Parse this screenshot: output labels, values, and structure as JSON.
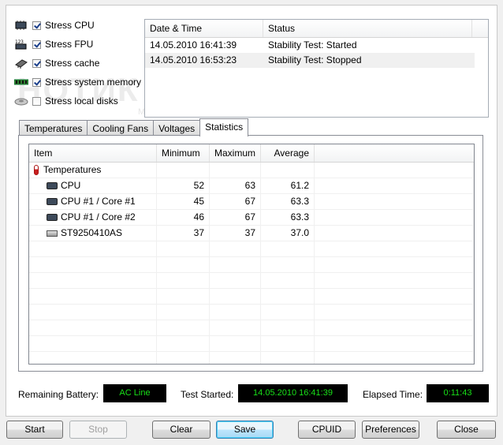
{
  "stress_options": [
    {
      "icon": "cpu-chip-icon",
      "label": "Stress CPU",
      "checked": true
    },
    {
      "icon": "fpu-123-icon",
      "label": "Stress FPU",
      "checked": true
    },
    {
      "icon": "cache-chip-icon",
      "label": "Stress cache",
      "checked": true
    },
    {
      "icon": "memory-module-icon",
      "label": "Stress system memory",
      "checked": true
    },
    {
      "icon": "disk-icon",
      "label": "Stress local disks",
      "checked": false
    }
  ],
  "log": {
    "columns": [
      "Date & Time",
      "Status"
    ],
    "rows": [
      {
        "time": "14.05.2010 16:41:39",
        "status": "Stability Test: Started"
      },
      {
        "time": "14.05.2010 16:53:23",
        "status": "Stability Test: Stopped"
      }
    ]
  },
  "watermark": {
    "logo": "НОТИК",
    "tagline": "МАГАЗИНЫ НОУТБУКОВ"
  },
  "tabs": [
    "Temperatures",
    "Cooling Fans",
    "Voltages",
    "Statistics"
  ],
  "active_tab": "Statistics",
  "stats": {
    "columns": [
      "Item",
      "Minimum",
      "Maximum",
      "Average"
    ],
    "group": "Temperatures",
    "rows": [
      {
        "icon": "cpu-chip-icon",
        "item": "CPU",
        "min": "52",
        "max": "63",
        "avg": "61.2"
      },
      {
        "icon": "cpu-chip-icon",
        "item": "CPU #1 / Core #1",
        "min": "45",
        "max": "67",
        "avg": "63.3"
      },
      {
        "icon": "cpu-chip-icon",
        "item": "CPU #1 / Core #2",
        "min": "46",
        "max": "67",
        "avg": "63.3"
      },
      {
        "icon": "hard-drive-icon",
        "item": "ST9250410AS",
        "min": "37",
        "max": "37",
        "avg": "37.0"
      }
    ]
  },
  "status_bar": {
    "battery_label": "Remaining Battery:",
    "battery_value": "AC Line",
    "started_label": "Test Started:",
    "started_value": "14.05.2010 16:41:39",
    "elapsed_label": "Elapsed Time:",
    "elapsed_value": "0:11:43",
    "value_color": "#18e018"
  },
  "buttons": {
    "start": "Start",
    "stop": "Stop",
    "clear": "Clear",
    "save": "Save",
    "cpuid": "CPUID",
    "preferences": "Preferences",
    "close": "Close"
  }
}
